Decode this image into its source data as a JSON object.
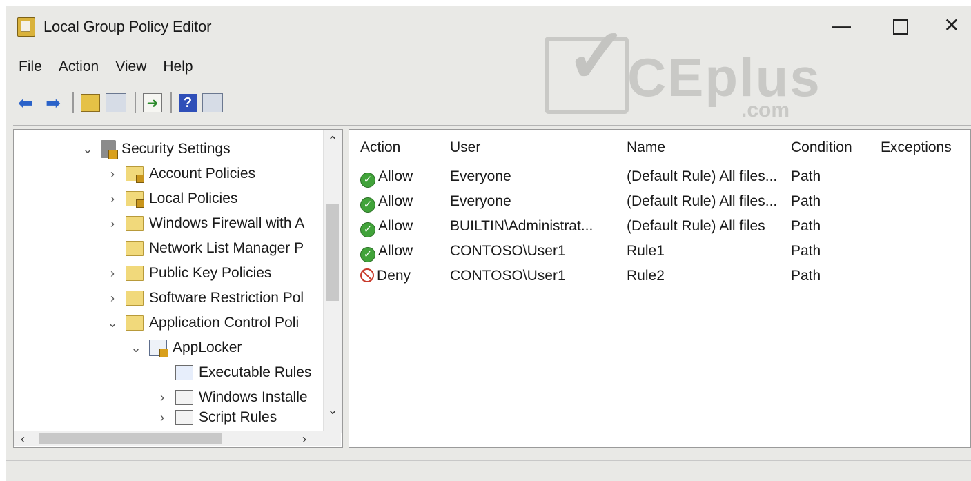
{
  "window": {
    "title": "Local Group Policy Editor",
    "controls": {
      "minimize": "—",
      "maximize": "",
      "close": "✕"
    }
  },
  "watermark": {
    "text": "CEplus",
    "suffix": ".com"
  },
  "menu": [
    "File",
    "Action",
    "View",
    "Help"
  ],
  "toolbar": {
    "back": "⬅",
    "forward": "➡",
    "help": "?"
  },
  "tree": {
    "items": [
      {
        "label": "Security Settings",
        "chevron": "⌄",
        "expanded": true
      },
      {
        "label": "Account Policies",
        "chevron": "›"
      },
      {
        "label": "Local Policies",
        "chevron": "›"
      },
      {
        "label": "Windows Firewall with A",
        "chevron": "›"
      },
      {
        "label": "Network List Manager P",
        "chevron": ""
      },
      {
        "label": "Public Key Policies",
        "chevron": "›"
      },
      {
        "label": "Software Restriction Pol",
        "chevron": "›"
      },
      {
        "label": "Application Control Poli",
        "chevron": "⌄",
        "expanded": true
      },
      {
        "label": "AppLocker",
        "chevron": "⌄",
        "expanded": true
      },
      {
        "label": "Executable Rules",
        "chevron": "",
        "selected": true
      },
      {
        "label": "Windows Installe",
        "chevron": "›"
      },
      {
        "label": "Script Rules",
        "chevron": "›"
      }
    ],
    "scroll": {
      "up": "⌃",
      "down": "⌄",
      "left": "‹",
      "right": "›"
    }
  },
  "list": {
    "columns": [
      "Action",
      "User",
      "Name",
      "Condition",
      "Exceptions"
    ],
    "rows": [
      {
        "action": "Allow",
        "user": "Everyone",
        "name": "(Default Rule) All files...",
        "condition": "Path",
        "exceptions": ""
      },
      {
        "action": "Allow",
        "user": "Everyone",
        "name": "(Default Rule) All files...",
        "condition": "Path",
        "exceptions": ""
      },
      {
        "action": "Allow",
        "user": "BUILTIN\\Administrat...",
        "name": "(Default Rule) All files",
        "condition": "Path",
        "exceptions": ""
      },
      {
        "action": "Allow",
        "user": "CONTOSO\\User1",
        "name": "Rule1",
        "condition": "Path",
        "exceptions": ""
      },
      {
        "action": "Deny",
        "user": "CONTOSO\\User1",
        "name": "Rule2",
        "condition": "Path",
        "exceptions": ""
      }
    ]
  },
  "colors": {
    "allow": "#41a33a",
    "deny": "#c83a2b",
    "window_bg": "#e9e9e6"
  }
}
